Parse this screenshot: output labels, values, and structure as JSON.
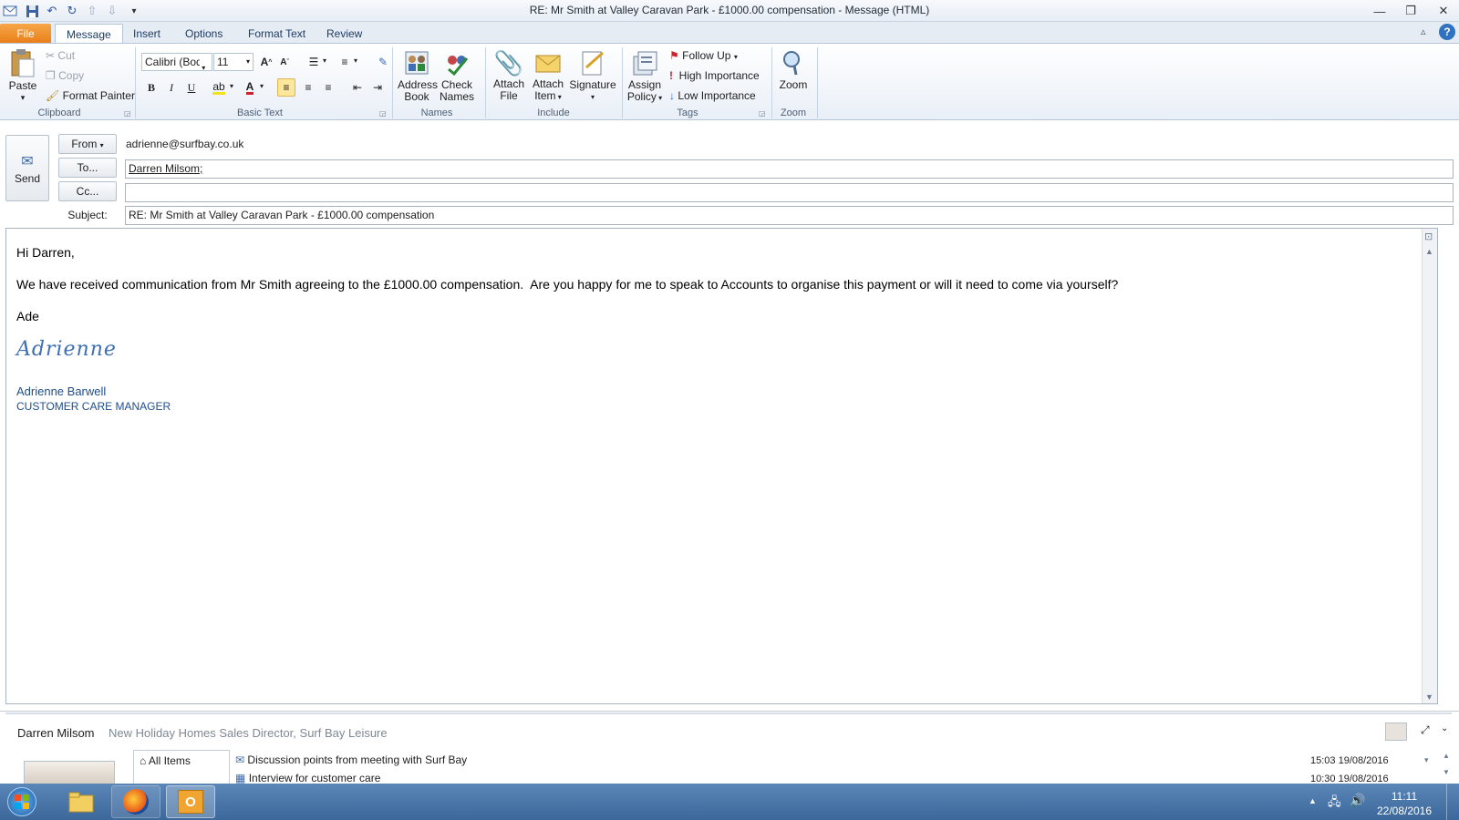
{
  "window": {
    "title": "RE: Mr Smith at Valley Caravan Park - £1000.00 compensation  -  Message (HTML)"
  },
  "tabs": [
    "File",
    "Message",
    "Insert",
    "Options",
    "Format Text",
    "Review"
  ],
  "ribbon": {
    "clipboard": {
      "paste": "Paste",
      "cut": "Cut",
      "copy": "Copy",
      "format_painter": "Format Painter",
      "label": "Clipboard"
    },
    "basic_text": {
      "font": "Calibri (Body)",
      "size": "11",
      "label": "Basic Text"
    },
    "names": {
      "address_book_1": "Address",
      "address_book_2": "Book",
      "check_names_1": "Check",
      "check_names_2": "Names",
      "label": "Names"
    },
    "include": {
      "attach_file_1": "Attach",
      "attach_file_2": "File",
      "attach_item_1": "Attach",
      "attach_item_2": "Item",
      "signature": "Signature",
      "label": "Include"
    },
    "tags": {
      "assign_policy_1": "Assign",
      "assign_policy_2": "Policy",
      "follow_up": "Follow Up",
      "high_importance": "High Importance",
      "low_importance": "Low Importance",
      "label": "Tags"
    },
    "zoom": {
      "zoom": "Zoom",
      "label": "Zoom"
    }
  },
  "header": {
    "send": "Send",
    "from_button": "From",
    "from_value": "adrienne@surfbay.co.uk",
    "to_button": "To...",
    "to_value": "Darren Milsom;",
    "cc_button": "Cc...",
    "cc_value": "",
    "subject_label": "Subject:",
    "subject_value": "RE: Mr Smith at Valley Caravan Park - £1000.00 compensation"
  },
  "body": {
    "greeting": "Hi Darren,",
    "paragraph": "We have received communication from Mr Smith agreeing to the £1000.00 compensation.  Are you happy for me to speak to Accounts to organise this payment or will it need to come via yourself?",
    "signoff": "Ade",
    "signature_script": "Adrienne",
    "signature_name": "Adrienne Barwell",
    "signature_title": "CUSTOMER CARE MANAGER"
  },
  "people_pane": {
    "name": "Darren Milsom",
    "role": "New Holiday Homes Sales Director, Surf Bay Leisure",
    "filter": "All Items",
    "items": [
      {
        "subject": "Discussion points from meeting with Surf Bay",
        "time": "15:03  19/08/2016"
      },
      {
        "subject": "Interview for customer care",
        "time": "10:30  19/08/2016"
      }
    ]
  },
  "taskbar": {
    "time": "11:11",
    "date": "22/08/2016"
  }
}
